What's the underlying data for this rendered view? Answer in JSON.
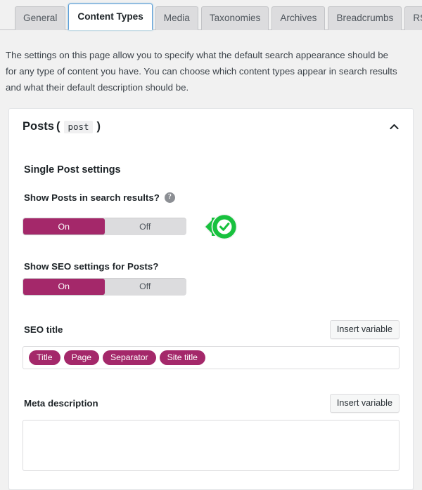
{
  "tabs": [
    {
      "label": "General",
      "active": false
    },
    {
      "label": "Content Types",
      "active": true
    },
    {
      "label": "Media",
      "active": false
    },
    {
      "label": "Taxonomies",
      "active": false
    },
    {
      "label": "Archives",
      "active": false
    },
    {
      "label": "Breadcrumbs",
      "active": false
    },
    {
      "label": "RSS",
      "active": false
    }
  ],
  "intro": {
    "text": "The settings on this page allow you to specify what the default search appearance should be for any type of content you have. You can choose which content types appear in search results and what their default description should be."
  },
  "card": {
    "title": "Posts",
    "paren_open": "(",
    "code_chip": "post",
    "paren_close": ")",
    "collapse_icon": "chevron-up-icon",
    "section_heading": "Single Post settings",
    "fields": {
      "show_in_search": {
        "label": "Show Posts in search results?",
        "help_icon": "?",
        "on_label": "On",
        "off_label": "Off",
        "selected": "On"
      },
      "show_seo_settings": {
        "label": "Show SEO settings for Posts?",
        "on_label": "On",
        "off_label": "Off",
        "selected": "On"
      },
      "seo_title": {
        "label": "SEO title",
        "insert_variable_label": "Insert variable",
        "value_tokens": [
          "Title",
          "Page",
          "Separator",
          "Site title"
        ]
      },
      "meta_description": {
        "label": "Meta description",
        "insert_variable_label": "Insert variable",
        "value": ""
      }
    }
  },
  "annotation": {
    "marker_icon": "green-cursor-check-icon",
    "color": "#18c13e"
  },
  "colors": {
    "accent_magenta": "#a4286a",
    "page_bg": "#f1f1f1",
    "active_tab_border": "#5b9dd9",
    "annotation_green": "#18c13e"
  }
}
